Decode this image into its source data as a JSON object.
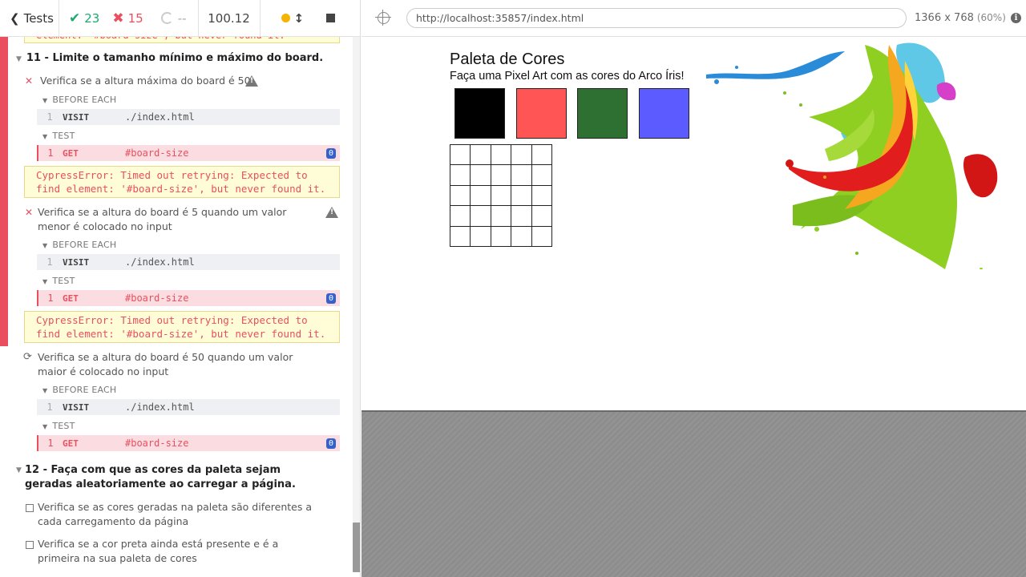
{
  "reporter": {
    "tests_label": "Tests",
    "passed": "23",
    "failed": "15",
    "pending": "--",
    "duration": "100.12"
  },
  "prev_error_tail": "element: '#board-size', but never found it.",
  "suite11": {
    "title": "11 - Limite o tamanho mínimo e máximo do board.",
    "tests": [
      {
        "title": "Verifica se a altura máxima do board é 50",
        "before_each_label": "BEFORE EACH",
        "visit": {
          "num": "1",
          "name": "VISIT",
          "msg": "./index.html"
        },
        "test_label": "TEST",
        "get": {
          "num": "1",
          "name": "GET",
          "msg": "#board-size",
          "badge": "0"
        },
        "error": "CypressError: Timed out retrying: Expected to find element: '#board-size', but never found it."
      },
      {
        "title": "Verifica se a altura do board é 5 quando um valor menor é colocado no input",
        "before_each_label": "BEFORE EACH",
        "visit": {
          "num": "1",
          "name": "VISIT",
          "msg": "./index.html"
        },
        "test_label": "TEST",
        "get": {
          "num": "1",
          "name": "GET",
          "msg": "#board-size",
          "badge": "0"
        },
        "error": "CypressError: Timed out retrying: Expected to find element: '#board-size', but never found it."
      },
      {
        "title": "Verifica se a altura do board é 50 quando um valor maior é colocado no input",
        "before_each_label": "BEFORE EACH",
        "visit": {
          "num": "1",
          "name": "VISIT",
          "msg": "./index.html"
        },
        "test_label": "TEST",
        "get": {
          "num": "1",
          "name": "GET",
          "msg": "#board-size",
          "badge": "0"
        }
      }
    ]
  },
  "suite12": {
    "title": "12 - Faça com que as cores da paleta sejam geradas aleatoriamente ao carregar a página.",
    "tests": [
      {
        "title": "Verifica se as cores geradas na paleta são diferentes a cada carregamento da página"
      },
      {
        "title": "Verifica se a cor preta ainda está presente e é a primeira na sua paleta de cores"
      }
    ]
  },
  "aut": {
    "url": "http://localhost:35857/index.html",
    "viewport": "1366 x 768",
    "scale": "(60%)",
    "info": "i"
  },
  "page": {
    "title": "Paleta de Cores",
    "subtitle": "Faça uma Pixel Art com as cores do Arco Íris!",
    "palette_colors": [
      "#000000",
      "#ff5555",
      "#2e7031",
      "#5b5bff"
    ]
  },
  "icons": {
    "back": "chevron-left-icon",
    "pass": "check-icon",
    "fail": "x-icon",
    "pending": "circle-notch-icon",
    "running": "dot-icon",
    "resize": "arrows-vertical-icon",
    "stop": "stop-icon",
    "selector": "crosshair-icon",
    "warn": "warning-icon",
    "info": "info-icon"
  },
  "colors": {
    "fail": "#e94f5f",
    "pass": "#1fa971",
    "badge": "#3462cc",
    "running": "#f4b400"
  }
}
